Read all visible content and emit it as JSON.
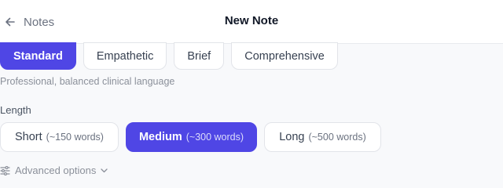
{
  "header": {
    "back_label": "Notes",
    "title": "New Note"
  },
  "tone": {
    "options": [
      {
        "label": "Standard",
        "selected": true
      },
      {
        "label": "Empathetic",
        "selected": false
      },
      {
        "label": "Brief",
        "selected": false
      },
      {
        "label": "Comprehensive",
        "selected": false
      }
    ],
    "description": "Professional, balanced clinical language"
  },
  "length": {
    "label": "Length",
    "options": [
      {
        "label": "Short",
        "detail": "(~150 words)",
        "selected": false
      },
      {
        "label": "Medium",
        "detail": "(~300 words)",
        "selected": true
      },
      {
        "label": "Long",
        "detail": "(~500 words)",
        "selected": false
      }
    ]
  },
  "advanced": {
    "label": "Advanced options",
    "icon": "sliders-icon",
    "chevron": "chevron-down-icon"
  },
  "colors": {
    "accent": "#4f46e5",
    "background": "#f8f9fb"
  }
}
